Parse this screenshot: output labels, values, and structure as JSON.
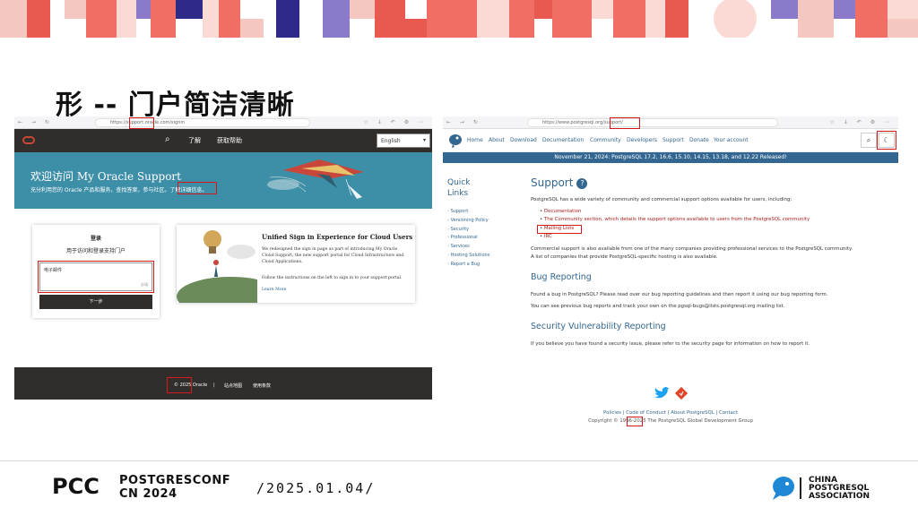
{
  "slide_title": "形 -- 门户简洁清晰",
  "oracle": {
    "browser": {
      "nav_glyphs": "← → ↻",
      "url": "https://support.oracle.com/signin",
      "tool_glyphs": "☆ ↓ ↶ ⚙ ⋯"
    },
    "nav": {
      "search_glyph": "⌕",
      "link_1": "了解",
      "link_2": "获取帮助",
      "language": "English",
      "caret": "▾"
    },
    "hero": {
      "title": "欢迎访问 My Oracle Support",
      "subtitle": "充分利用您的 Oracle 产品和服务，查找答案，参与社区。",
      "subtitle_link": "了解详细信息。"
    },
    "login": {
      "heading": "登录",
      "prompt": "用于访问和登录支持门户",
      "field_label": "电子邮件",
      "field_hint": "必填",
      "next_button": "下一步"
    },
    "card": {
      "title": "Unified Sign in Experience for Cloud Users",
      "body": "We redesigned the sign in page as part of introducing My Oracle Cloud Support, the new support portal for Cloud Infrastructure and Cloud Applications.",
      "footnote": "Follow the instructions on the left to sign in to your support portal.",
      "link": "Learn More"
    },
    "footer": {
      "copyright": "© 2025 Oracle",
      "divider": "|",
      "link_1": "站点地图",
      "link_2": "使用条款"
    }
  },
  "postgres": {
    "browser": {
      "nav_glyphs": "← → ↻",
      "url": "https://www.postgresql.org/support/",
      "tool_glyphs": "☆ ↓ ↶ ⚙ ⋯"
    },
    "nav": {
      "links": [
        "Home",
        "About",
        "Download",
        "Documentation",
        "Community",
        "Developers",
        "Support",
        "Donate",
        "Your account"
      ],
      "search_glyph": "⌕",
      "theme_glyph": "☾"
    },
    "banner": "November 21, 2024: PostgreSQL 17.2, 16.6, 15.10, 14.15, 13.18, and 12.22 Released!",
    "quick_links": {
      "title_1": "Quick",
      "title_2": "Links",
      "items": [
        "Support",
        "Versioning Policy",
        "Security",
        "Professional",
        "Services",
        "Hosting Solutions",
        "Report a Bug"
      ]
    },
    "support": {
      "title": "Support",
      "help_glyph": "?",
      "intro": "PostgreSQL has a wide variety of community and commercial support options available for users, including:",
      "bullets": [
        "Documentation",
        "The Community section, which details the support options available to users from the PostgreSQL community",
        "Mailing Lists",
        "IRC"
      ],
      "commercial_1": "Commercial support is also available from one of the many companies providing professional services to the PostgreSQL community.",
      "commercial_2": "A list of companies that provide PostgreSQL-specific hosting is also available."
    },
    "bug": {
      "title": "Bug Reporting",
      "line_1": "Found a bug in PostgreSQL? Please read over our bug reporting guidelines and then report it using our bug reporting form.",
      "line_2": "You can see previous bug reports and track your own on the pgsql-bugs@lists.postgresql.org mailing list."
    },
    "security": {
      "title": "Security Vulnerability Reporting",
      "line_1": "If you believe you have found a security issue, please refer to the security page for information on how to report it."
    },
    "footer": {
      "links": "Policies | Code of Conduct | About PostgreSQL | Contact",
      "copyright": "Copyright © 1996-2025 The PostgreSQL Global Development Group"
    }
  },
  "event": {
    "logo_text": "PCC",
    "conf_line_1": "POSTGRESCONF",
    "conf_line_2": "CN 2024",
    "date": "/2025.01.04/",
    "assoc_1": "CHINA",
    "assoc_2": "POSTGRESQL",
    "assoc_3": "ASSOCIATION"
  },
  "colors": {
    "oracle_dark": "#312d2a",
    "oracle_teal": "#3d8fa8",
    "postgres_blue": "#336791",
    "highlight_red": "#d21a1a"
  }
}
